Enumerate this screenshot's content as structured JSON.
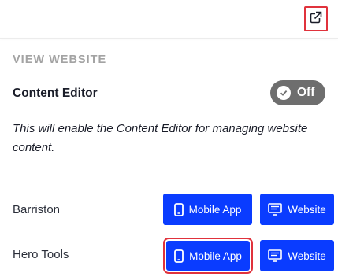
{
  "panel": {
    "section_title": "VIEW WEBSITE",
    "content_editor": {
      "label": "Content Editor",
      "toggle_text": "Off",
      "description": "This will enable the Content Editor for managing website content."
    }
  },
  "sites": [
    {
      "name": "Barriston",
      "mobile_app_label": "Mobile App",
      "website_label": "Website"
    },
    {
      "name": "Hero Tools",
      "mobile_app_label": "Mobile App",
      "website_label": "Website"
    }
  ],
  "icons": {
    "top_right": "external-link-icon",
    "mobile": "phone-icon",
    "website": "monitor-icon",
    "toggle": "check-icon"
  },
  "colors": {
    "primary_button": "#0a3cff",
    "toggle_off": "#6e6e6e",
    "highlight": "#e0323c"
  }
}
